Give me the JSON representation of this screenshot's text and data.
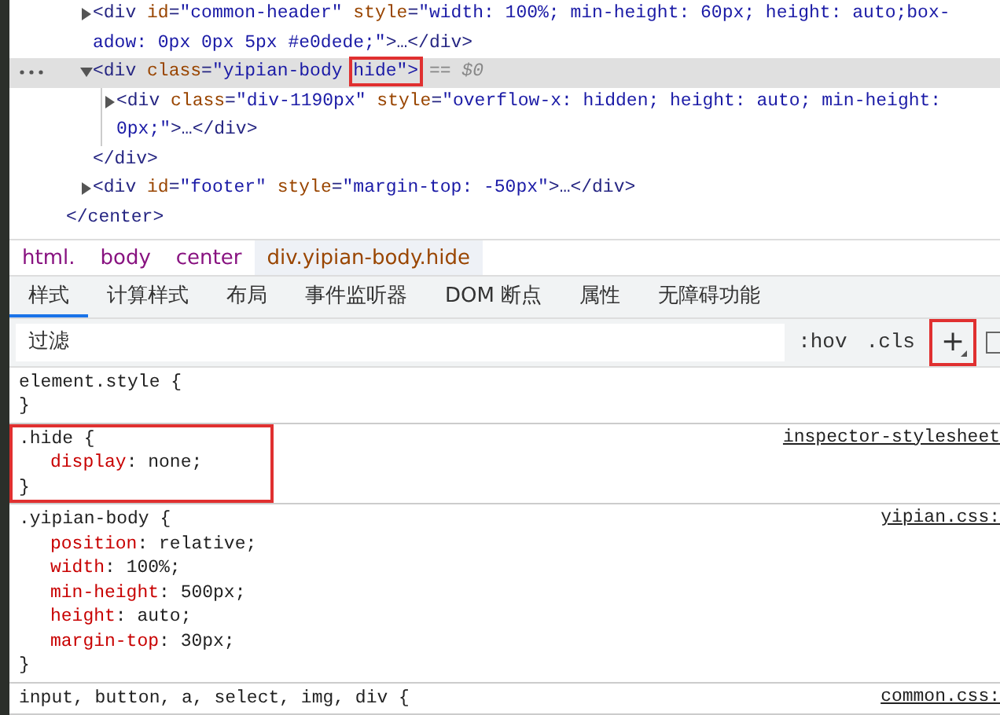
{
  "dom_tree": {
    "nodes": [
      {
        "expanded": false,
        "selected": false,
        "lines": [
          [
            {
              "kind": "tag",
              "text": "<div"
            },
            {
              "kind": "attr",
              "text": " id"
            },
            {
              "kind": "punct",
              "text": "="
            },
            {
              "kind": "value",
              "text": "\"common-header\""
            },
            {
              "kind": "attr",
              "text": " style"
            },
            {
              "kind": "punct",
              "text": "="
            },
            {
              "kind": "value",
              "text": "\"width: 100%; min-height: 60px; height: auto;box-"
            }
          ],
          [
            {
              "kind": "value",
              "text": "adow: 0px 0px 5px #e0dede;\""
            },
            {
              "kind": "tag",
              "text": ">"
            },
            {
              "kind": "plain",
              "text": "…"
            },
            {
              "kind": "tag",
              "text": "</div>"
            }
          ]
        ]
      },
      {
        "expanded": true,
        "selected": true,
        "lines": [
          [
            {
              "kind": "tag",
              "text": "<div"
            },
            {
              "kind": "attr",
              "text": " class"
            },
            {
              "kind": "punct",
              "text": "="
            },
            {
              "kind": "value",
              "text": "\"yipian-body "
            },
            {
              "kind": "boxed_value",
              "text": "hide\">"
            },
            {
              "kind": "ref",
              "text": " == $0"
            }
          ]
        ],
        "children": [
          {
            "expanded": false,
            "selected": false,
            "lines": [
              [
                {
                  "kind": "tag",
                  "text": "<div"
                },
                {
                  "kind": "attr",
                  "text": " class"
                },
                {
                  "kind": "punct",
                  "text": "="
                },
                {
                  "kind": "value",
                  "text": "\"div-1190px\""
                },
                {
                  "kind": "attr",
                  "text": " style"
                },
                {
                  "kind": "punct",
                  "text": "="
                },
                {
                  "kind": "value",
                  "text": "\"overflow-x: hidden; height: auto; min-height: "
                }
              ],
              [
                {
                  "kind": "value",
                  "text": "0px;\""
                },
                {
                  "kind": "tag",
                  "text": ">"
                },
                {
                  "kind": "plain",
                  "text": "…"
                },
                {
                  "kind": "tag",
                  "text": "</div>"
                }
              ]
            ]
          }
        ],
        "closing": "</div>"
      },
      {
        "expanded": false,
        "selected": false,
        "lines": [
          [
            {
              "kind": "tag",
              "text": "<div"
            },
            {
              "kind": "attr",
              "text": " id"
            },
            {
              "kind": "punct",
              "text": "="
            },
            {
              "kind": "value",
              "text": "\"footer\""
            },
            {
              "kind": "attr",
              "text": " style"
            },
            {
              "kind": "punct",
              "text": "="
            },
            {
              "kind": "value",
              "text": "\"margin-top: -50px\""
            },
            {
              "kind": "tag",
              "text": ">"
            },
            {
              "kind": "plain",
              "text": "…"
            },
            {
              "kind": "tag",
              "text": "</div>"
            }
          ]
        ]
      }
    ],
    "closing": "</center>"
  },
  "breadcrumbs": [
    {
      "label": "html.",
      "selected": false
    },
    {
      "label": "body",
      "selected": false
    },
    {
      "label": "center",
      "selected": false
    },
    {
      "label": "div.yipian-body.hide",
      "selected": true
    }
  ],
  "tabs": [
    {
      "label": "样式",
      "selected": true
    },
    {
      "label": "计算样式",
      "selected": false
    },
    {
      "label": "布局",
      "selected": false
    },
    {
      "label": "事件监听器",
      "selected": false
    },
    {
      "label": "DOM 断点",
      "selected": false
    },
    {
      "label": "属性",
      "selected": false
    },
    {
      "label": "无障碍功能",
      "selected": false
    }
  ],
  "filter": {
    "placeholder": "过滤",
    "buttons": [
      {
        "kind": "text",
        "label": ":hov",
        "highlighted": false
      },
      {
        "kind": "text",
        "label": ".cls",
        "highlighted": false
      },
      {
        "kind": "plus",
        "label": "+",
        "highlighted": true
      }
    ]
  },
  "rules": [
    {
      "selector": "element.style {",
      "highlighted": false,
      "closing": "}"
    },
    {
      "selector": ".hide {",
      "source": "inspector-stylesheet",
      "highlighted": true,
      "declarations": [
        {
          "property": "display",
          "value": ": none;"
        }
      ],
      "closing": "}"
    },
    {
      "selector": ".yipian-body {",
      "source": "yipian.css:",
      "highlighted": false,
      "declarations": [
        {
          "property": "position",
          "value": ": relative;"
        },
        {
          "property": "width",
          "value": ": 100%;"
        },
        {
          "property": "min-height",
          "value": ": 500px;"
        },
        {
          "property": "height",
          "value": ": auto;"
        },
        {
          "property": "margin-top",
          "value": ": 30px;"
        }
      ],
      "closing": "}"
    },
    {
      "selector": "input, button, a, select, img, div {",
      "source": "common.css:",
      "highlighted": false
    }
  ]
}
